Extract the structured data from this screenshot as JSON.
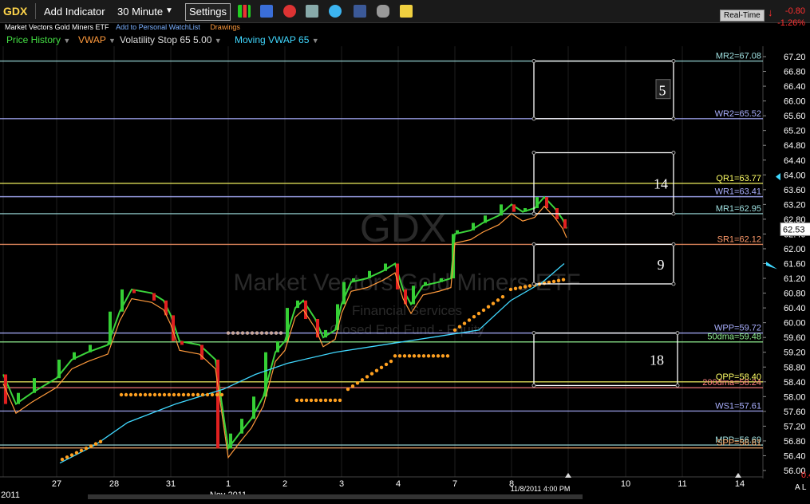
{
  "toolbar": {
    "symbol": "GDX",
    "add_indicator": "Add Indicator",
    "interval": "30 Minute",
    "settings": "Settings",
    "realtime": "Real-Time",
    "change": "-0.80",
    "change_pct": "-1.26%"
  },
  "subheader": {
    "name": "Market Vectors Gold Miners ETF",
    "watchlist": "Add to Personal WatchList",
    "drawings": "Drawings"
  },
  "indicators": [
    {
      "label": "Price History",
      "color": "#44e044"
    },
    {
      "label": "VWAP",
      "color": "#ff9a3c"
    },
    {
      "label": "Volatility Stop 65 5.00",
      "color": "#dddddd"
    },
    {
      "label": "Moving VWAP 65",
      "color": "#40d8ff"
    }
  ],
  "watermark": {
    "symbol": "GDX",
    "name": "Market Vectors Gold Miners ETF",
    "sector": "Financial Services",
    "industry": "Closed End Fund - Equity"
  },
  "levels": [
    {
      "label": "MR2=67.08",
      "value": 67.08,
      "color": "#9fe0e0"
    },
    {
      "label": "WR2=65.52",
      "value": 65.52,
      "color": "#aab0ff"
    },
    {
      "label": "QR1=63.77",
      "value": 63.77,
      "color": "#ffff66"
    },
    {
      "label": "WR1=63.41",
      "value": 63.41,
      "color": "#aab0ff"
    },
    {
      "label": "MR1=62.95",
      "value": 62.95,
      "color": "#9fe0e0"
    },
    {
      "label": "SR1=62.12",
      "value": 62.12,
      "color": "#ff9a6a"
    },
    {
      "label": "WPP=59.72",
      "value": 59.72,
      "color": "#aab0ff"
    },
    {
      "label": "50dma=59.48",
      "value": 59.48,
      "color": "#90ee90"
    },
    {
      "label": "QPP=58.40",
      "value": 58.4,
      "color": "#ffff66"
    },
    {
      "label": "200dma=58.24",
      "value": 58.24,
      "color": "#ff8080"
    },
    {
      "label": "WS1=57.61",
      "value": 57.61,
      "color": "#aab0ff"
    },
    {
      "label": "MPP=56.69",
      "value": 56.69,
      "color": "#9fe0e0"
    },
    {
      "label": "SPP=56.61",
      "value": 56.61,
      "color": "#ffb070"
    }
  ],
  "boxes": [
    {
      "label": "5",
      "top": 67.08,
      "bottom": 65.52
    },
    {
      "label": "14",
      "top": 64.6,
      "bottom": 62.95
    },
    {
      "label": "9",
      "top": 62.12,
      "bottom": 61.05
    },
    {
      "label": "18",
      "top": 59.72,
      "bottom": 58.3
    }
  ],
  "y_ticks": [
    "67.20",
    "66.80",
    "66.40",
    "66.00",
    "65.60",
    "65.20",
    "64.80",
    "64.40",
    "64.00",
    "63.60",
    "63.20",
    "62.80",
    "62.40",
    "62.00",
    "61.60",
    "61.20",
    "60.80",
    "60.40",
    "60.00",
    "59.60",
    "59.20",
    "58.80",
    "58.40",
    "58.00",
    "57.60",
    "57.20",
    "56.80",
    "56.40",
    "56.00"
  ],
  "price_tag": "62.53",
  "x_labels": [
    {
      "text": "2011",
      "i": -1
    },
    {
      "text": "27",
      "i": 0
    },
    {
      "text": "28",
      "i": 1
    },
    {
      "text": "31",
      "i": 2
    },
    {
      "text": "1",
      "i": 3
    },
    {
      "text": "Nov 2011",
      "i": 3.0
    },
    {
      "text": "2",
      "i": 4
    },
    {
      "text": "3",
      "i": 5
    },
    {
      "text": "4",
      "i": 6
    },
    {
      "text": "7",
      "i": 7
    },
    {
      "text": "8",
      "i": 8
    },
    {
      "text": "10",
      "i": 10
    },
    {
      "text": "11",
      "i": 11
    },
    {
      "text": "14",
      "i": 12
    }
  ],
  "timestamp": "11/8/2011 4:00 PM",
  "corner": {
    "value": "0.4",
    "mode": "A L"
  }
}
